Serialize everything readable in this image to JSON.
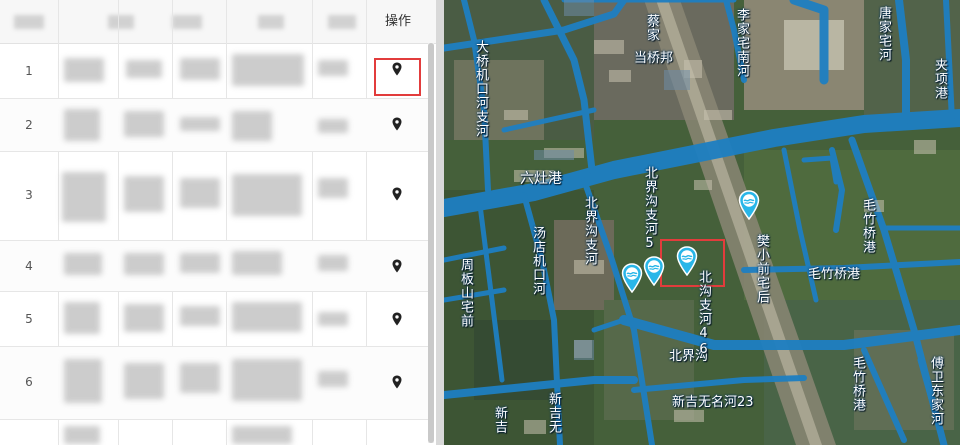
{
  "table": {
    "header": {
      "op_label": "操作"
    },
    "rows": [
      {
        "num": "1"
      },
      {
        "num": "2"
      },
      {
        "num": "3"
      },
      {
        "num": "4"
      },
      {
        "num": "5"
      },
      {
        "num": "6"
      }
    ],
    "row_action_icon": "map-pin-icon"
  },
  "map": {
    "labels": {
      "dakou": "大桥机口河支河",
      "jiajia": "蔡家",
      "daqiao_t": "当桥邦",
      "lijia": "李家宅南河",
      "tangjia": "唐家宅河",
      "jiaxiang": "夹项港",
      "liuzhu": "六灶港",
      "beijie_zhi": "北界沟支河",
      "beijie5": "北界沟支河5",
      "beijie_vert": "北界沟支河",
      "tangdian": "汤店机口河",
      "zhouban": "周板山宅前",
      "zhouqian": "樊小前宅后",
      "maozhu_gang": "毛竹桥港",
      "maozhu_h": "毛竹桥港",
      "beijiegou": "北界沟",
      "beijie46": "北沟支河46",
      "xinji_h": "新吉无名河23",
      "xinji_v1": "新吉无",
      "xinji_v2": "新吉",
      "maozhu_v": "毛竹桥港",
      "fuwei": "傅卫东家河"
    },
    "marker_icon": "water-station-icon",
    "marker_color": "#29b6e8",
    "river_color": "#1e7fc2",
    "highlight_color": "#e23c3c"
  }
}
